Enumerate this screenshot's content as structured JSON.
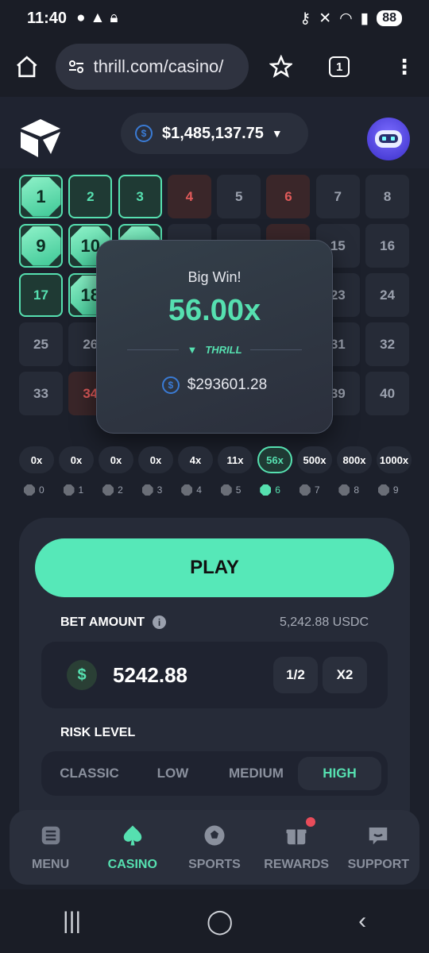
{
  "status": {
    "time": "11:40",
    "battery": "88"
  },
  "browser": {
    "url": "thrill.com/casino/",
    "tabs": "1"
  },
  "header": {
    "balance": "$1,485,137.75"
  },
  "grid": [
    {
      "n": "1",
      "s": "hit"
    },
    {
      "n": "2",
      "s": "pick"
    },
    {
      "n": "3",
      "s": "pick"
    },
    {
      "n": "4",
      "s": "miss"
    },
    {
      "n": "5",
      "s": ""
    },
    {
      "n": "6",
      "s": "miss"
    },
    {
      "n": "7",
      "s": ""
    },
    {
      "n": "8",
      "s": ""
    },
    {
      "n": "9",
      "s": "hit"
    },
    {
      "n": "10",
      "s": "hit"
    },
    {
      "n": "",
      "s": "hit"
    },
    {
      "n": "",
      "s": ""
    },
    {
      "n": "",
      "s": ""
    },
    {
      "n": "",
      "s": "miss"
    },
    {
      "n": "15",
      "s": ""
    },
    {
      "n": "16",
      "s": ""
    },
    {
      "n": "17",
      "s": "pick"
    },
    {
      "n": "18",
      "s": "hit"
    },
    {
      "n": "",
      "s": ""
    },
    {
      "n": "",
      "s": ""
    },
    {
      "n": "",
      "s": ""
    },
    {
      "n": "",
      "s": ""
    },
    {
      "n": "23",
      "s": ""
    },
    {
      "n": "24",
      "s": ""
    },
    {
      "n": "25",
      "s": ""
    },
    {
      "n": "26",
      "s": ""
    },
    {
      "n": "",
      "s": ""
    },
    {
      "n": "",
      "s": ""
    },
    {
      "n": "",
      "s": ""
    },
    {
      "n": "",
      "s": ""
    },
    {
      "n": "31",
      "s": ""
    },
    {
      "n": "32",
      "s": ""
    },
    {
      "n": "33",
      "s": ""
    },
    {
      "n": "34",
      "s": "miss"
    },
    {
      "n": "",
      "s": ""
    },
    {
      "n": "",
      "s": ""
    },
    {
      "n": "",
      "s": ""
    },
    {
      "n": "",
      "s": ""
    },
    {
      "n": "39",
      "s": ""
    },
    {
      "n": "40",
      "s": ""
    }
  ],
  "popup": {
    "title": "Big Win!",
    "multiplier": "56.00x",
    "brand": "THRILL",
    "win": "$293601.28"
  },
  "payouts": [
    "0x",
    "0x",
    "0x",
    "0x",
    "4x",
    "11x",
    "56x",
    "500x",
    "800x",
    "1000x"
  ],
  "payout_active": 6,
  "counts": [
    "0",
    "1",
    "2",
    "3",
    "4",
    "5",
    "6",
    "7",
    "8",
    "9"
  ],
  "controls": {
    "play": "PLAY",
    "bet_label": "BET AMOUNT",
    "balance_usdc": "5,242.88 USDC",
    "bet_value": "5242.88",
    "half": "1/2",
    "double": "X2",
    "risk_label": "RISK LEVEL",
    "risk_options": [
      "CLASSIC",
      "LOW",
      "MEDIUM",
      "HIGH"
    ],
    "risk_active": 3
  },
  "nav": [
    "MENU",
    "CASINO",
    "SPORTS",
    "REWARDS",
    "SUPPORT"
  ],
  "nav_active": 1,
  "accent": "#56e0b0"
}
